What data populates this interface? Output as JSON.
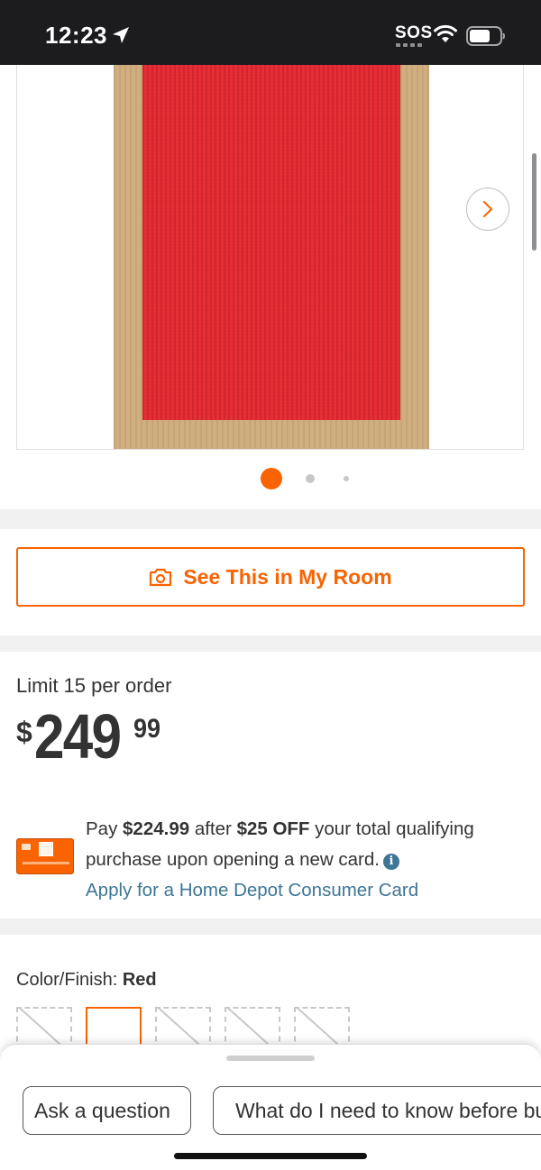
{
  "status_bar": {
    "time": "12:23",
    "sos": "SOS",
    "icons": [
      "location-arrow-icon",
      "wifi-icon",
      "battery-icon"
    ]
  },
  "gallery": {
    "image_alt": "Red jute rug with natural border",
    "dot_count": 3,
    "active_dot": 1,
    "next_icon": "chevron-right-icon"
  },
  "ar_button": {
    "label": "See This in My Room",
    "icon": "camera-icon"
  },
  "pricing": {
    "limit_text": "Limit 15 per order",
    "currency": "$",
    "dollars": "249",
    "cents": "99"
  },
  "card_offer": {
    "pay_prefix": "Pay ",
    "discounted_price": "$224.99",
    "after_text": " after ",
    "discount": "$25 OFF",
    "rest_text": " your total qualifying purchase upon opening a new card.",
    "link_text": "Apply for a Home Depot Consumer Card",
    "info_icon": "info-icon"
  },
  "color_finish": {
    "label": "Color/Finish: ",
    "value": "Red",
    "swatch_count": 5,
    "selected_index": 1
  },
  "bottom_sheet": {
    "ask_label": "Ask a question",
    "know_label": "What do I need to know before buying?",
    "know_icon": "hexagon-icon"
  },
  "colors": {
    "accent": "#f96302",
    "link": "#3e7697",
    "text": "#333333",
    "rug_red": "#e42d34",
    "rug_border": "#cfae80"
  }
}
